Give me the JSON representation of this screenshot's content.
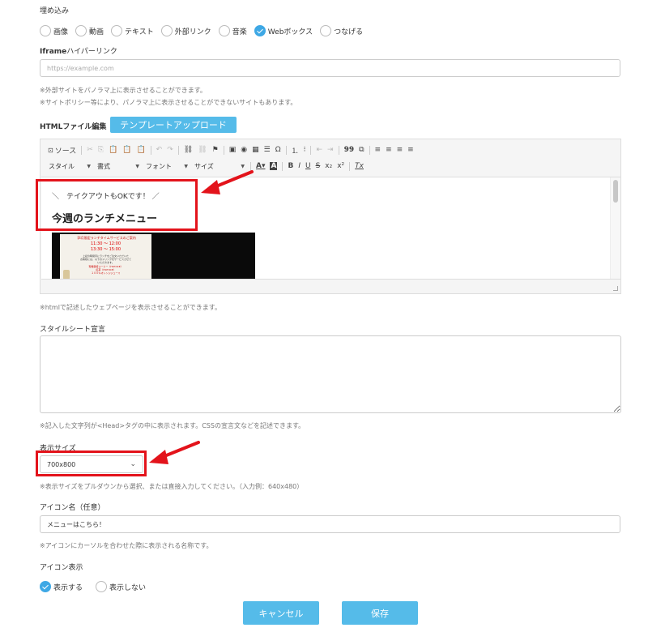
{
  "embed": {
    "label": "埋め込み",
    "options": [
      {
        "label": "画像",
        "checked": false
      },
      {
        "label": "動画",
        "checked": false
      },
      {
        "label": "テキスト",
        "checked": false
      },
      {
        "label": "外部リンク",
        "checked": false
      },
      {
        "label": "音楽",
        "checked": false
      },
      {
        "label": "Webボックス",
        "checked": true
      },
      {
        "label": "つなげる",
        "checked": false
      }
    ]
  },
  "iframe": {
    "label_bold": "Iframe",
    "label_rest": "ハイパーリンク",
    "placeholder": "https://example.com",
    "note1": "※外部サイトをパノラマ上に表示させることができます。",
    "note2": "※サイトポリシー等により、パノラマ上に表示させることができないサイトもあります。"
  },
  "html_editor": {
    "label": "HTMLファイル編集",
    "upload_button": "テンプレートアップロード",
    "toolbar": {
      "source": "ソース",
      "style_combo": "スタイル",
      "format_combo": "書式",
      "font_combo": "フォント",
      "size_combo": "サイズ",
      "bold": "B",
      "italic": "I",
      "underline": "U",
      "strike": "S",
      "subscript": "x₂",
      "superscript": "x²",
      "remove_format": "Tx",
      "omega": "Ω",
      "quote": "99"
    },
    "content": {
      "line1": "＼　テイクアウトもOKです！ ／",
      "heading": "今週のランチメニュー",
      "image_text": [
        "【4月限定ランチタイムサービスのご案内",
        "11:30 ～ 12:00",
        "13:30 ～ 15:00",
        "上記の時間帯にランチをご注文いただいた",
        "お客様には、以下のドリンクをサービスさせて",
        "いただきます。",
        "有機栽培コーヒー（HOT/ICE）",
        "紅茶（HOT/ICE）",
        "１００％オレンジジュース"
      ]
    },
    "note": "※htmlで記述したウェブページを表示させることができます。"
  },
  "stylesheet": {
    "label": "スタイルシート宣言",
    "value": "",
    "note": "※記入した文字列が<Head>タグの中に表示されます。CSSの宣言文などを記述できます。"
  },
  "display_size": {
    "label": "表示サイズ",
    "value": "700x800",
    "note": "※表示サイズをプルダウンから選択、または直接入力してください。（入力例：640x480）"
  },
  "icon_name": {
    "label": "アイコン名（任意）",
    "value": "メニューはこちら！",
    "note": "※アイコンにカーソルを合わせた際に表示される名称です。"
  },
  "icon_display": {
    "label": "アイコン表示",
    "options": [
      {
        "label": "表示する",
        "checked": true
      },
      {
        "label": "表示しない",
        "checked": false
      }
    ]
  },
  "buttons": {
    "cancel": "キャンセル",
    "save": "保存"
  },
  "colors": {
    "accent": "#55bbe9",
    "radio_checked": "#3ea8e5",
    "annotation_red": "#e3131b"
  }
}
